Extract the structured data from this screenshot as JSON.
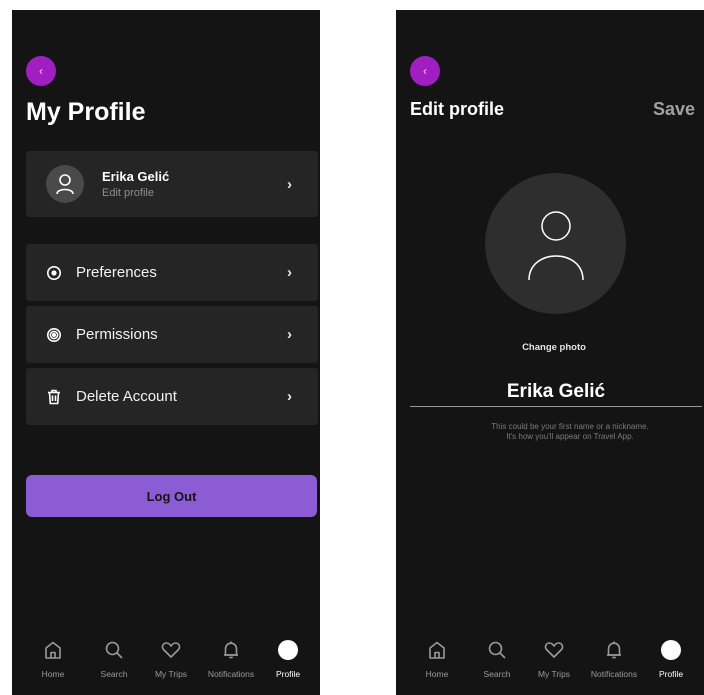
{
  "profile_screen": {
    "back_label": "‹",
    "title": "My Profile",
    "user": {
      "name": "Erika Gelić",
      "subtitle": "Edit profile"
    },
    "chevron": "›",
    "menu": [
      {
        "label": "Preferences",
        "icon": "preferences-icon"
      },
      {
        "label": "Permissions",
        "icon": "permissions-icon"
      },
      {
        "label": "Delete Account",
        "icon": "trash-icon"
      }
    ],
    "logout_label": "Log Out"
  },
  "edit_screen": {
    "back_label": "‹",
    "title": "Edit profile",
    "save_label": "Save",
    "change_photo_label": "Change photo",
    "name_value": "Erika Gelić",
    "helper_line1": "This could be your first name or a nickname.",
    "helper_line2": "It's how you'll appear on Travel App."
  },
  "tabbar": {
    "tabs": [
      {
        "label": "Home",
        "icon": "home-icon"
      },
      {
        "label": "Search",
        "icon": "search-icon"
      },
      {
        "label": "My Trips",
        "icon": "heart-icon"
      },
      {
        "label": "Notifications",
        "icon": "bell-icon"
      },
      {
        "label": "Profile",
        "icon": "profile-dot-icon",
        "active": true
      }
    ]
  },
  "colors": {
    "background": "#141414",
    "card": "#252525",
    "accent_back": "#a11ec0",
    "logout": "#8b5cd4"
  }
}
